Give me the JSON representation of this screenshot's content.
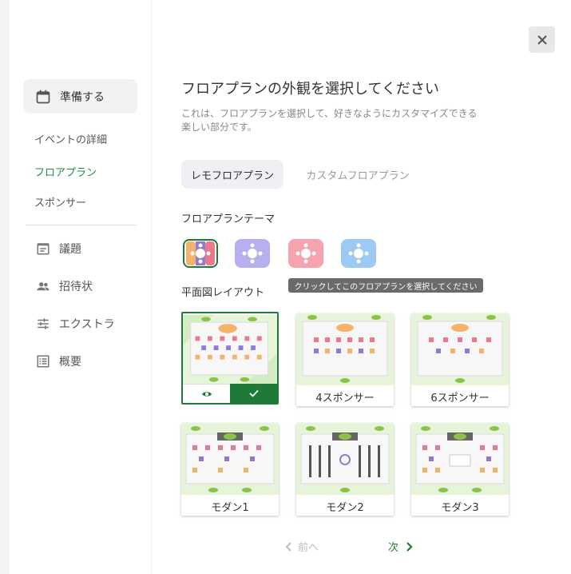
{
  "sidebar": {
    "prepare_label": "準備する",
    "sub_items": [
      "イベントの詳細",
      "フロアプラン",
      "スポンサー"
    ],
    "nav_items": [
      {
        "label": "議題",
        "icon": "agenda-icon"
      },
      {
        "label": "招待状",
        "icon": "people-icon"
      },
      {
        "label": "エクストラ",
        "icon": "sliders-icon"
      },
      {
        "label": "概要",
        "icon": "list-icon"
      }
    ]
  },
  "main": {
    "title": "フロアプランの外観を選択してください",
    "description": "これは、フロアプランを選択して、好きなようにカスタマイズできる楽しい部分です。",
    "tabs": [
      "レモフロアプラン",
      "カスタムフロアプラン"
    ],
    "theme_label": "フロアプランテーマ",
    "themes": [
      {
        "name": "multicolor",
        "colors": [
          "#f4b36b",
          "#8f7bd6",
          "#e97a8d"
        ],
        "selected": true
      },
      {
        "name": "lavender",
        "colors": [
          "#b7b0f0"
        ],
        "selected": false
      },
      {
        "name": "pink",
        "colors": [
          "#f5a3ad"
        ],
        "selected": false
      },
      {
        "name": "blue",
        "colors": [
          "#9ccaf2"
        ],
        "selected": false
      }
    ],
    "tooltip": "クリックしてこのフロアプランを選択してください",
    "layout_label": "平面図レイアウト",
    "layouts": [
      {
        "caption": "",
        "selected": true
      },
      {
        "caption": "4スポンサー",
        "selected": false
      },
      {
        "caption": "6スポンサー",
        "selected": false
      },
      {
        "caption": "モダン1",
        "selected": false
      },
      {
        "caption": "モダン2",
        "selected": false
      },
      {
        "caption": "モダン3",
        "selected": false
      }
    ],
    "pager": {
      "prev": "前へ",
      "next": "次"
    }
  },
  "colors": {
    "accent": "#1e7a36",
    "active_text": "#1e8e3e"
  }
}
